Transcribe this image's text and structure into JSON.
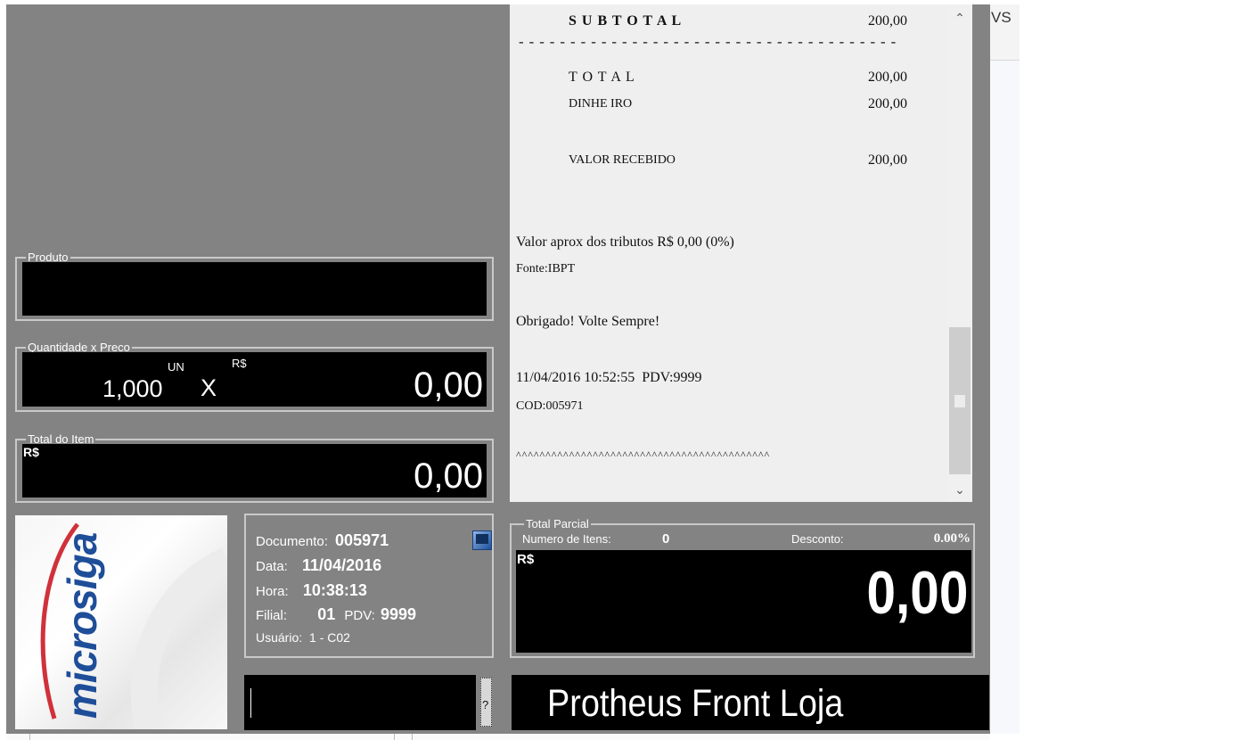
{
  "receipt": {
    "subtotal_label": "S U B T O T A L",
    "subtotal_value": "200,00",
    "dashes": "-------------------------------------",
    "total_label": "T O T A L",
    "total_value": "200,00",
    "dinheiro_label": "DINHE IRO",
    "dinheiro_value": "200,00",
    "recebido_label": "VALOR RECEBIDO",
    "recebido_value": "200,00",
    "tributos": "Valor aprox dos tributos R$ 0,00 (0%)",
    "fonte": "Fonte:IBPT",
    "obrigado": "Obrigado! Volte Sempre!",
    "datetime_pdv": "11/04/2016 10:52:55  PDV:9999",
    "cod": "COD:005971",
    "carets": "^^^^^^^^^^^^^^^^^^^^^^^^^^^^^^^^^^^^^^^^^^^"
  },
  "background_text": "VS",
  "produto": {
    "label": "Produto",
    "value": ""
  },
  "quantidade": {
    "label": "Quantidade x Preco",
    "qty": "1,000",
    "unit": "UN",
    "x": "X",
    "currency": "R$",
    "price": "0,00"
  },
  "total_item": {
    "label": "Total do Item",
    "currency": "R$",
    "value": "0,00"
  },
  "logo": {
    "text": "microsiga"
  },
  "info": {
    "documento_label": "Documento:",
    "documento_value": "005971",
    "data_label": "Data:",
    "data_value": "11/04/2016",
    "hora_label": "Hora:",
    "hora_value": "10:38:13",
    "filial_label": "Filial:",
    "filial_value": "01",
    "pdv_label": "PDV:",
    "pdv_value": "9999",
    "usuario_label": "Usuário:",
    "usuario_value": "1 - C02"
  },
  "total_parcial": {
    "label": "Total Parcial",
    "itens_label": "Numero de Itens:",
    "itens_value": "0",
    "desconto_label": "Desconto:",
    "desconto_value": "0.00%",
    "currency": "R$",
    "value": "0,00"
  },
  "command": {
    "value": "",
    "help": "?"
  },
  "banner": {
    "text": "Protheus Front Loja"
  }
}
